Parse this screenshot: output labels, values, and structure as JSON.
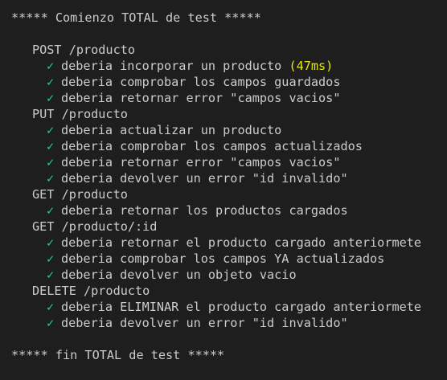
{
  "header": "***** Comienzo TOTAL de test *****",
  "footer": "***** fin TOTAL de test *****",
  "check_glyph": "✓",
  "colors": {
    "background": "#1e1e1e",
    "text": "#cccccc",
    "check": "#23d18b",
    "timing": "#e5e510"
  },
  "suites": [
    {
      "title": "POST /producto",
      "tests": [
        {
          "text": "deberia incorporar un producto",
          "timing": "(47ms)"
        },
        {
          "text": "deberia comprobar los campos guardados"
        },
        {
          "text": "deberia retornar error \"campos vacios\""
        }
      ]
    },
    {
      "title": "PUT /producto",
      "tests": [
        {
          "text": "deberia actualizar un producto"
        },
        {
          "text": "deberia comprobar los campos actualizados"
        },
        {
          "text": "deberia retornar error \"campos vacios\""
        },
        {
          "text": "deberia devolver un error \"id invalido\""
        }
      ]
    },
    {
      "title": "GET /producto",
      "tests": [
        {
          "text": "deberia retornar los productos cargados"
        }
      ]
    },
    {
      "title": "GET /producto/:id",
      "tests": [
        {
          "text": "deberia retornar el producto cargado anteriormete"
        },
        {
          "text": "deberia comprobar los campos YA actualizados"
        },
        {
          "text": "deberia devolver un objeto vacio"
        }
      ]
    },
    {
      "title": "DELETE /producto",
      "tests": [
        {
          "text": "deberia ELIMINAR el producto cargado anteriormete"
        },
        {
          "text": "deberia devolver un error \"id invalido\""
        }
      ]
    }
  ]
}
